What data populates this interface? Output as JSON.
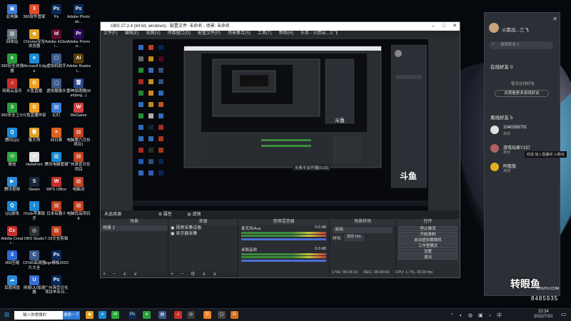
{
  "desktop": {
    "icons": [
      {
        "label": "此电脑",
        "glyph": "▣",
        "color": "#3a7bd5"
      },
      {
        "label": "360软件管家",
        "glyph": "3",
        "color": "#e04a2d"
      },
      {
        "label": "Ps",
        "glyph": "Ps",
        "color": "#0a2a5a"
      },
      {
        "label": "Adobe Photosh...",
        "glyph": "Ps",
        "color": "#0a2a5a"
      },
      {
        "label": "回收站",
        "glyph": "▥",
        "color": "#6b7780"
      },
      {
        "label": "Chrome安全浏览器",
        "glyph": "◉",
        "color": "#e0a020"
      },
      {
        "label": "Adobe InDesi...",
        "glyph": "Id",
        "color": "#5a0a2a"
      },
      {
        "label": "Adobe Premie...",
        "glyph": "Pr",
        "color": "#2a0a5a"
      },
      {
        "label": "360安全浏览器",
        "glyph": "e",
        "color": "#2a9d3a"
      },
      {
        "label": "Microsoft Edge",
        "glyph": "e",
        "color": "#1a8ad5"
      },
      {
        "label": "虚拟机助手",
        "glyph": "▢",
        "color": "#3a5a8a"
      },
      {
        "label": "Adobe Illustrat...",
        "glyph": "Ai",
        "color": "#5a3a0a"
      },
      {
        "label": "网易云音乐",
        "glyph": "♫",
        "color": "#c4302b"
      },
      {
        "label": "斗鱼直播",
        "glyph": "D",
        "color": "#f0a020"
      },
      {
        "label": "虚拟摄像头",
        "glyph": "▢",
        "color": "#3a5a8a"
      },
      {
        "label": "雷神加速器(Mahjong...)",
        "glyph": "雷",
        "color": "#2a4a8a"
      },
      {
        "label": "360安全卫士",
        "glyph": "3",
        "color": "#2a9d3a"
      },
      {
        "label": "斗鱼直播伴侣",
        "glyph": "D",
        "color": "#f0a020"
      },
      {
        "label": "幻灯",
        "glyph": "▤",
        "color": "#3a7bd5"
      },
      {
        "label": "WeGame",
        "glyph": "W",
        "color": "#d04040"
      },
      {
        "label": "腾讯QQ",
        "glyph": "Q",
        "color": "#1a8ad5"
      },
      {
        "label": "鲁大师",
        "glyph": "鲁",
        "color": "#e0a020"
      },
      {
        "label": "向日葵",
        "glyph": "☀",
        "color": "#e06020"
      },
      {
        "label": "电脑第六月份项目1",
        "glyph": "▤",
        "color": "#c04020"
      },
      {
        "label": "微信",
        "glyph": "✉",
        "color": "#2aa83a"
      },
      {
        "label": "HelloFont",
        "glyph": "H",
        "color": "#e0e0e0"
      },
      {
        "label": "腾讯电脑管家",
        "glyph": "▥",
        "color": "#1a8ad5"
      },
      {
        "label": "广州清宜日化项目",
        "glyph": "▤",
        "color": "#c04020"
      },
      {
        "label": "腾讯视频",
        "glyph": "▶",
        "color": "#2a8ad5"
      },
      {
        "label": "Steam",
        "glyph": "S",
        "color": "#1b2838"
      },
      {
        "label": "WPS Office",
        "glyph": "W",
        "color": "#c4302b"
      },
      {
        "label": "电脑词",
        "glyph": "▤",
        "color": "#c04020"
      },
      {
        "label": "QQ游戏",
        "glyph": "Q",
        "color": "#1a8ad5"
      },
      {
        "label": "iTools苹果助手",
        "glyph": "i",
        "color": "#1a8ad5"
      },
      {
        "label": "日本有趣人",
        "glyph": "▤",
        "color": "#c04020"
      },
      {
        "label": "电脑优品项目8",
        "glyph": "▤",
        "color": "#c04020"
      },
      {
        "label": "Adobe Creati...",
        "glyph": "Cc",
        "color": "#c4302b"
      },
      {
        "label": "OBS Studio",
        "glyph": "◎",
        "color": "#303030"
      },
      {
        "label": "7.18文化剪辑",
        "glyph": "▤",
        "color": "#c04020"
      },
      {
        "label": "",
        "glyph": "",
        "color": "transparent"
      },
      {
        "label": "360压缩",
        "glyph": "3",
        "color": "#2a6ad5"
      },
      {
        "label": "CFHD高清图片大全",
        "glyph": "C",
        "color": "#3a5a8a"
      },
      {
        "label": "logo模板2023",
        "glyph": "Ps",
        "color": "#0a2a5a"
      },
      {
        "label": "",
        "glyph": "",
        "color": "transparent"
      },
      {
        "label": "百度网盘",
        "glyph": "☁",
        "color": "#2a8ad5"
      },
      {
        "label": "网易UU加速器",
        "glyph": "U",
        "color": "#3a6ad5"
      },
      {
        "label": "广州清宜日化项目毕业日...",
        "glyph": "Ps",
        "color": "#0a2a5a"
      }
    ]
  },
  "obs": {
    "title": "OBS 27.2.4 (64 bit, windows) - 配置文件: 未命名 - 场景: 未命名",
    "menu": [
      "文件(F)",
      "编辑(E)",
      "视图(V)",
      "停靠窗口(D)",
      "配置文件(P)",
      "场景集合(S)",
      "工具(T)",
      "帮助(H)",
      "头条 - 火箭出...三飞"
    ],
    "preview_caption": "头条平台开播(0.02)",
    "context_bar": {
      "no_source": "未选择源",
      "properties": "属性",
      "filters": "滤镜"
    },
    "scenes": {
      "header": "场景",
      "items": [
        "场景 2"
      ]
    },
    "sources": {
      "header": "来源",
      "items": [
        "视频采集设备",
        "显示器采集"
      ]
    },
    "mixer": {
      "header": "音频混音器",
      "channels": [
        {
          "name": "麦克风/Aux",
          "db": "0.0 dB"
        },
        {
          "name": "桌面音频",
          "db": "0.0 dB"
        }
      ]
    },
    "transitions": {
      "header": "场景转场",
      "type": "淡出",
      "duration_label": "时长",
      "duration": "300 ms"
    },
    "controls": {
      "header": "控件",
      "buttons": [
        "停止推流",
        "开始录制",
        "启动虚拟摄像机",
        "工作室模式",
        "设置",
        "退出"
      ]
    },
    "status": {
      "live": "LIVE: 00:26:10",
      "rec": "REC: 00:00:00",
      "cpu": "CPU: 1.7%, 30.00 fps"
    }
  },
  "qq": {
    "username": "火箭出...三飞",
    "search_placeholder": "搜索联系人",
    "online_header": "在线好友",
    "online_count": "0",
    "online_empty": "暂无在线好友",
    "online_button": "去观看更多游戏好友",
    "offline_header": "离线好友",
    "offline_count": "5",
    "friends": [
      {
        "name": "1040358701",
        "status": "离线"
      },
      {
        "name": "游戏玩家Y157",
        "status": "离线"
      },
      {
        "name": "阿煌煌",
        "status": "离线"
      }
    ],
    "chat_popup": "欢迎 加入直播间 火箭出"
  },
  "taskbar": {
    "search": "输入你想搜的",
    "search_button": "搜索一下",
    "time": "15:34",
    "date": "2022/7/31"
  },
  "watermark": {
    "text": "转眼鱼",
    "url": "DOUYU.COM",
    "room": "8485935"
  }
}
